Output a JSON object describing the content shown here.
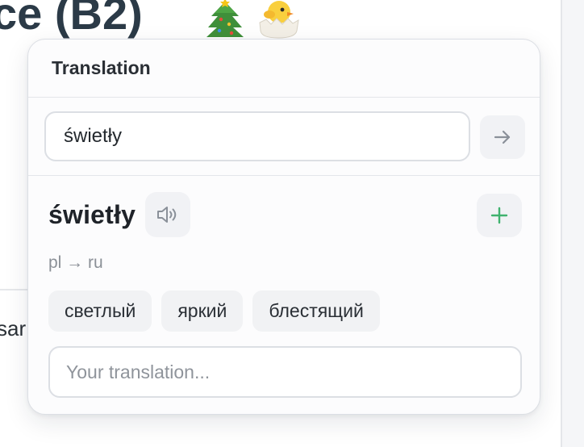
{
  "background": {
    "heading": "ce (B2)",
    "emojis": [
      "christmas-tree-emoji",
      "hatching-chick-emoji"
    ],
    "partial_text": "sar"
  },
  "popover": {
    "title": "Translation",
    "search": {
      "value": "świetły"
    },
    "result": {
      "word": "świetły",
      "lang_pair": "pl → ru",
      "translations": [
        "светлый",
        "яркий",
        "блестящий"
      ],
      "translation_input": {
        "placeholder": "Your translation...",
        "value": ""
      }
    },
    "icons": {
      "submit": "arrow-right-icon",
      "audio": "speaker-icon",
      "add": "plus-icon"
    },
    "colors": {
      "add_accent": "#3fb26e",
      "icon_gray": "#8a9099"
    }
  }
}
